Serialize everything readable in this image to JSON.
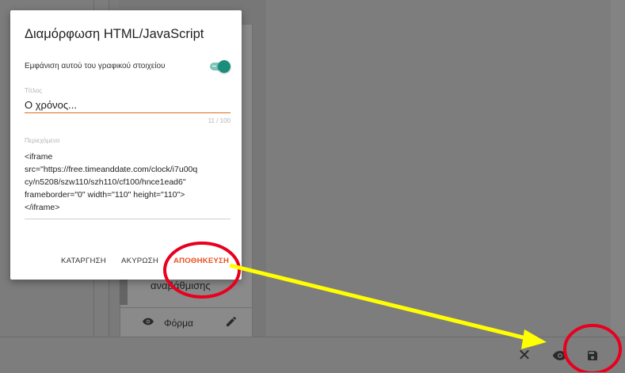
{
  "dialog": {
    "title": "Διαμόρφωση HTML/JavaScript",
    "toggle_label": "Εμφάνιση αυτού του γραφικού στοιχείου",
    "title_field": {
      "label": "Τίτλος",
      "value": "Ο χρόνος...",
      "counter": "11 / 100"
    },
    "content_field": {
      "label": "Περιεχόμενο",
      "value": "<iframe\nsrc=\"https://free.timeanddate.com/clock/i7u00q\ncy/n5208/szw110/szh110/cf100/hnce1ead6\"\nframeborder=\"0\" width=\"110\" height=\"110\">\n</iframe>"
    },
    "actions": {
      "delete": "ΚΑΤΑΡΓΗΣΗ",
      "cancel": "ΑΚΥΡΩΣΗ",
      "save": "ΑΠΟΘΗΚΕΥΣΗ"
    }
  },
  "background": {
    "card_text": "αναβάθμισης",
    "forma_label": "Φόρμα"
  },
  "bottom_bar": {
    "close_glyph": "✕"
  },
  "colors": {
    "accent": "#e8511d",
    "toggle": "#1a8e7a",
    "annotation_circle": "#e8001e",
    "annotation_arrow": "#ffff00"
  },
  "icons": [
    "close-icon",
    "eye-icon",
    "save-icon",
    "pencil-icon"
  ]
}
